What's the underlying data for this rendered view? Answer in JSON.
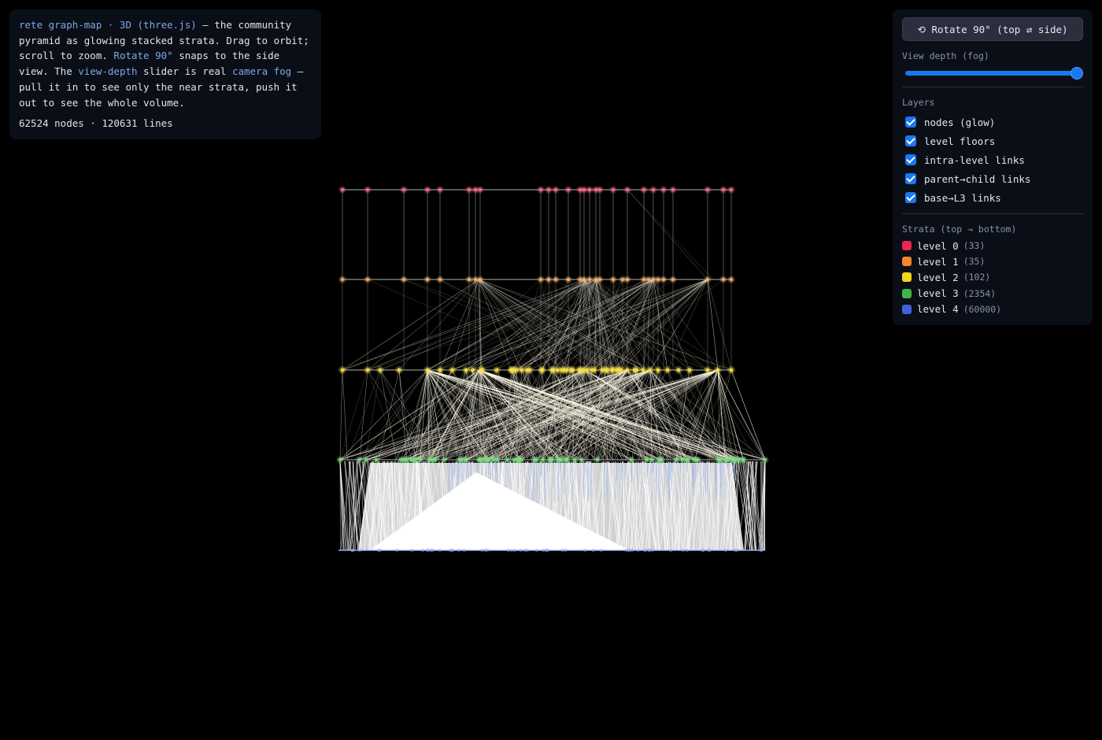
{
  "info": {
    "title_part": "rete graph-map · 3D (three.js)",
    "desc_1": " — the community pyramid as glowing stacked strata. Drag to orbit; scroll to zoom. ",
    "rotate_ref": "Rotate 90°",
    "desc_2": " snaps to the side view. The ",
    "slider_ref": "view-depth",
    "desc_3": " slider is real ",
    "fog_ref": "camera fog",
    "desc_4": " — pull it in to see only the near strata, push it out to see the whole volume.",
    "stats": "62524 nodes · 120631 lines"
  },
  "controls": {
    "rotate_button": "⟲ Rotate 90° (top ⇄ side)",
    "depth_label": "View depth (fog)",
    "depth_value": 1.0,
    "layers_title": "Layers",
    "layers": [
      {
        "label": "nodes (glow)",
        "checked": true
      },
      {
        "label": "level floors",
        "checked": true
      },
      {
        "label": "intra-level links",
        "checked": true
      },
      {
        "label": "parent→child links",
        "checked": true
      },
      {
        "label": "base→L3 links",
        "checked": true
      }
    ],
    "strata_title": "Strata (top → bottom)",
    "strata": [
      {
        "label": "level 0",
        "count": "(33)",
        "color": "#e8264f"
      },
      {
        "label": "level 1",
        "count": "(35)",
        "color": "#f5862c"
      },
      {
        "label": "level 2",
        "count": "(102)",
        "color": "#f3d51d"
      },
      {
        "label": "level 3",
        "count": "(2354)",
        "color": "#3fb44a"
      },
      {
        "label": "level 4",
        "count": "(60000)",
        "color": "#3f63d8"
      }
    ]
  },
  "visual": {
    "background": "#000000",
    "link_color": "#fffbe8",
    "base_link_color": "#ffffff"
  }
}
